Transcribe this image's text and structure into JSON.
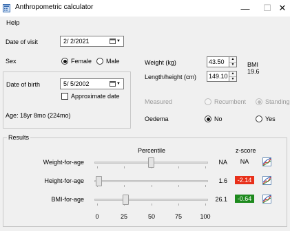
{
  "window": {
    "title": "Anthropometric calculator",
    "minimize": "—",
    "maximize": "☐",
    "close": "✕"
  },
  "menu": {
    "help": "Help"
  },
  "visit": {
    "label": "Date of visit",
    "value": "2/  2/2021"
  },
  "sex": {
    "label": "Sex",
    "female": "Female",
    "male": "Male",
    "selected": "Female"
  },
  "birth": {
    "label": "Date of birth",
    "value": "5/  5/2002",
    "approximate_label": "Approximate date",
    "approximate_checked": false
  },
  "age": {
    "text": "Age: 18yr 8mo (224mo)"
  },
  "weight": {
    "label": "Weight (kg)",
    "value": "43.50"
  },
  "height": {
    "label": "Length/height (cm)",
    "value": "149.10"
  },
  "bmi": {
    "label": "BMI",
    "value": "19.6"
  },
  "measured": {
    "label": "Measured",
    "recumbent": "Recumbent",
    "standing": "Standing",
    "selected": "Standing"
  },
  "oedema": {
    "label": "Oedema",
    "no": "No",
    "yes": "Yes",
    "selected": "No"
  },
  "results": {
    "title": "Results",
    "percentile_header": "Percentile",
    "zscore_header": "z-score",
    "scale": [
      "0",
      "25",
      "50",
      "75",
      "100"
    ],
    "rows": [
      {
        "label": "Weight-for-age",
        "percentile": "NA",
        "percentile_pos": 50,
        "zscore": "NA",
        "zscore_color": ""
      },
      {
        "label": "Height-for-age",
        "percentile": "1.6",
        "percentile_pos": 1.6,
        "zscore": "-2.14",
        "zscore_color": "#e8301a"
      },
      {
        "label": "BMI-for-age",
        "percentile": "26.1",
        "percentile_pos": 26.1,
        "zscore": "-0.64",
        "zscore_color": "#1e8a1e"
      }
    ]
  }
}
